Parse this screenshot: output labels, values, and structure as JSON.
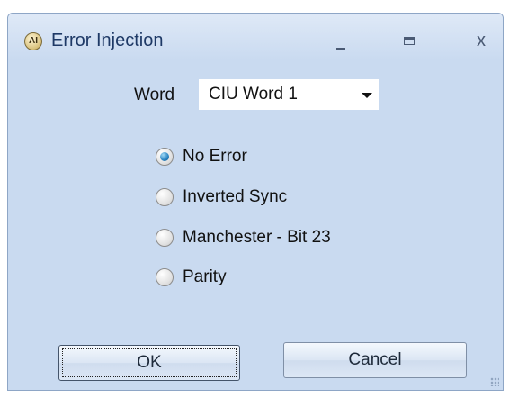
{
  "window": {
    "title": "Error Injection",
    "app_icon_text": "AI",
    "controls": {
      "minimize_glyph": "",
      "maximize_glyph": "",
      "close_glyph": "x"
    }
  },
  "word": {
    "label": "Word",
    "selected": "CIU Word 1"
  },
  "options": [
    {
      "label": "No Error",
      "checked": true
    },
    {
      "label": "Inverted Sync",
      "checked": false
    },
    {
      "label": "Manchester - Bit 23",
      "checked": false
    },
    {
      "label": "Parity",
      "checked": false
    }
  ],
  "buttons": {
    "ok": "OK",
    "cancel": "Cancel"
  },
  "colors": {
    "window_bg": "#c9daf0",
    "title_text": "#1e3966",
    "radio_selected": "#2a84c2"
  }
}
